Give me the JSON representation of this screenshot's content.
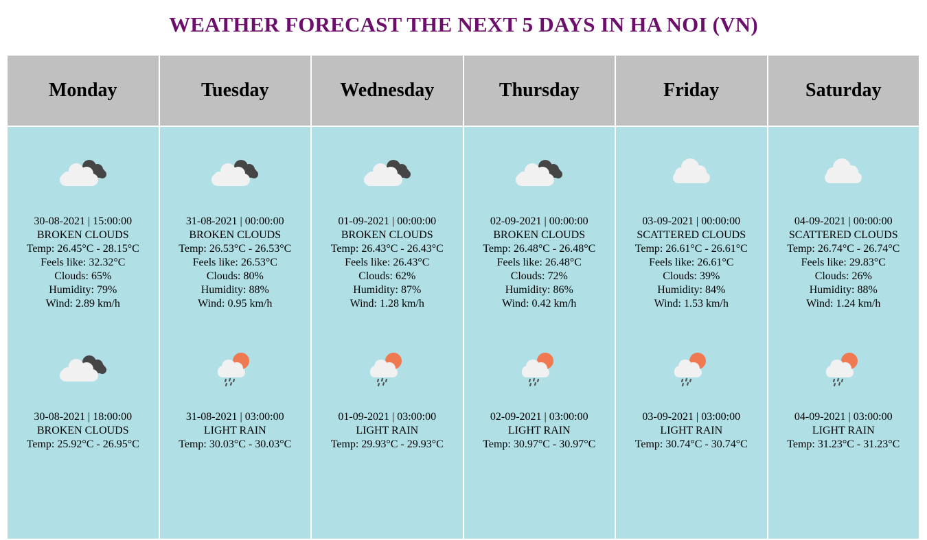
{
  "page": {
    "title": "WEATHER FORECAST THE NEXT 5 DAYS IN HA NOI (VN)"
  },
  "days": [
    {
      "name": "Monday",
      "slots": [
        {
          "icon": "broken-clouds-icon",
          "datetime": "30-08-2021 | 15:00:00",
          "description": "BROKEN CLOUDS",
          "temp": "Temp: 26.45°C - 28.15°C",
          "feels_like": "Feels like: 32.32°C",
          "clouds": "Clouds: 65%",
          "humidity": "Humidity: 79%",
          "wind": "Wind: 2.89 km/h"
        },
        {
          "icon": "broken-clouds-icon",
          "datetime": "30-08-2021 | 18:00:00",
          "description": "BROKEN CLOUDS",
          "temp": "Temp: 25.92°C - 26.95°C"
        }
      ]
    },
    {
      "name": "Tuesday",
      "slots": [
        {
          "icon": "broken-clouds-icon",
          "datetime": "31-08-2021 | 00:00:00",
          "description": "BROKEN CLOUDS",
          "temp": "Temp: 26.53°C - 26.53°C",
          "feels_like": "Feels like: 26.53°C",
          "clouds": "Clouds: 80%",
          "humidity": "Humidity: 88%",
          "wind": "Wind: 0.95 km/h"
        },
        {
          "icon": "light-rain-icon",
          "datetime": "31-08-2021 | 03:00:00",
          "description": "LIGHT RAIN",
          "temp": "Temp: 30.03°C - 30.03°C"
        }
      ]
    },
    {
      "name": "Wednesday",
      "slots": [
        {
          "icon": "broken-clouds-icon",
          "datetime": "01-09-2021 | 00:00:00",
          "description": "BROKEN CLOUDS",
          "temp": "Temp: 26.43°C - 26.43°C",
          "feels_like": "Feels like: 26.43°C",
          "clouds": "Clouds: 62%",
          "humidity": "Humidity: 87%",
          "wind": "Wind: 1.28 km/h"
        },
        {
          "icon": "light-rain-icon",
          "datetime": "01-09-2021 | 03:00:00",
          "description": "LIGHT RAIN",
          "temp": "Temp: 29.93°C - 29.93°C"
        }
      ]
    },
    {
      "name": "Thursday",
      "slots": [
        {
          "icon": "broken-clouds-icon",
          "datetime": "02-09-2021 | 00:00:00",
          "description": "BROKEN CLOUDS",
          "temp": "Temp: 26.48°C - 26.48°C",
          "feels_like": "Feels like: 26.48°C",
          "clouds": "Clouds: 72%",
          "humidity": "Humidity: 86%",
          "wind": "Wind: 0.42 km/h"
        },
        {
          "icon": "light-rain-icon",
          "datetime": "02-09-2021 | 03:00:00",
          "description": "LIGHT RAIN",
          "temp": "Temp: 30.97°C - 30.97°C"
        }
      ]
    },
    {
      "name": "Friday",
      "slots": [
        {
          "icon": "scattered-clouds-icon",
          "datetime": "03-09-2021 | 00:00:00",
          "description": "SCATTERED CLOUDS",
          "temp": "Temp: 26.61°C - 26.61°C",
          "feels_like": "Feels like: 26.61°C",
          "clouds": "Clouds: 39%",
          "humidity": "Humidity: 84%",
          "wind": "Wind: 1.53 km/h"
        },
        {
          "icon": "light-rain-icon",
          "datetime": "03-09-2021 | 03:00:00",
          "description": "LIGHT RAIN",
          "temp": "Temp: 30.74°C - 30.74°C"
        }
      ]
    },
    {
      "name": "Saturday",
      "slots": [
        {
          "icon": "scattered-clouds-icon",
          "datetime": "04-09-2021 | 00:00:00",
          "description": "SCATTERED CLOUDS",
          "temp": "Temp: 26.74°C - 26.74°C",
          "feels_like": "Feels like: 29.83°C",
          "clouds": "Clouds: 26%",
          "humidity": "Humidity: 88%",
          "wind": "Wind: 1.24 km/h"
        },
        {
          "icon": "light-rain-icon",
          "datetime": "04-09-2021 | 03:00:00",
          "description": "LIGHT RAIN",
          "temp": "Temp: 31.23°C - 31.23°C"
        }
      ]
    }
  ],
  "colors": {
    "title": "#6b0f6b",
    "header_bg": "#c0c0c0",
    "cell_bg": "#b0dfe5",
    "cloud_light": "#f1f1f1",
    "cloud_dark": "#454545",
    "sun": "#ef7a52",
    "rain": "#555555"
  }
}
